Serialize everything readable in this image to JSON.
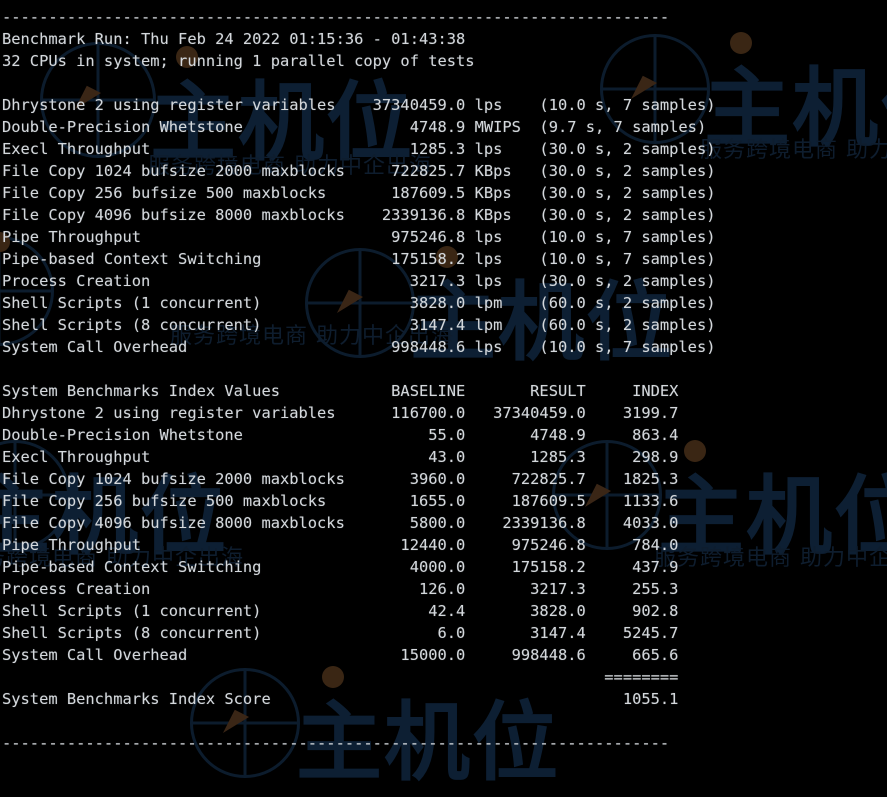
{
  "terminal": {
    "title": "UnixBench benchmark results terminal output",
    "background_color": "#000000",
    "text_color": "#d4d8dc",
    "rule_top": "------------------------------------------------------------------------",
    "rule_bottom": "------------------------------------------------------------------------",
    "header": {
      "benchmark_run_label": "Benchmark Run:",
      "date": "Thu Feb 24 2022",
      "time_start": "01:15:36",
      "time_separator": "-",
      "time_end": "01:43:38",
      "run_line": "Benchmark Run: Thu Feb 24 2022 01:15:36 - 01:43:38",
      "cpu_line": "32 CPUs in system; running 1 parallel copy of tests",
      "cpu_count": "32",
      "parallel_copies": "1"
    },
    "raw_results": {
      "rows": [
        {
          "name": "Dhrystone 2 using register variables",
          "value": "37340459.0",
          "unit": "lps",
          "duration": "10.0",
          "samples": "7",
          "detail": "(10.0 s, 7 samples)"
        },
        {
          "name": "Double-Precision Whetstone",
          "value": "4748.9",
          "unit": "MWIPS",
          "duration": "9.7",
          "samples": "7",
          "detail": "(9.7 s, 7 samples)"
        },
        {
          "name": "Execl Throughput",
          "value": "1285.3",
          "unit": "lps",
          "duration": "30.0",
          "samples": "2",
          "detail": "(30.0 s, 2 samples)"
        },
        {
          "name": "File Copy 1024 bufsize 2000 maxblocks",
          "value": "722825.7",
          "unit": "KBps",
          "duration": "30.0",
          "samples": "2",
          "detail": "(30.0 s, 2 samples)"
        },
        {
          "name": "File Copy 256 bufsize 500 maxblocks",
          "value": "187609.5",
          "unit": "KBps",
          "duration": "30.0",
          "samples": "2",
          "detail": "(30.0 s, 2 samples)"
        },
        {
          "name": "File Copy 4096 bufsize 8000 maxblocks",
          "value": "2339136.8",
          "unit": "KBps",
          "duration": "30.0",
          "samples": "2",
          "detail": "(30.0 s, 2 samples)"
        },
        {
          "name": "Pipe Throughput",
          "value": "975246.8",
          "unit": "lps",
          "duration": "10.0",
          "samples": "7",
          "detail": "(10.0 s, 7 samples)"
        },
        {
          "name": "Pipe-based Context Switching",
          "value": "175158.2",
          "unit": "lps",
          "duration": "10.0",
          "samples": "7",
          "detail": "(10.0 s, 7 samples)"
        },
        {
          "name": "Process Creation",
          "value": "3217.3",
          "unit": "lps",
          "duration": "30.0",
          "samples": "2",
          "detail": "(30.0 s, 2 samples)"
        },
        {
          "name": "Shell Scripts (1 concurrent)",
          "value": "3828.0",
          "unit": "lpm",
          "duration": "60.0",
          "samples": "2",
          "detail": "(60.0 s, 2 samples)"
        },
        {
          "name": "Shell Scripts (8 concurrent)",
          "value": "3147.4",
          "unit": "lpm",
          "duration": "60.0",
          "samples": "2",
          "detail": "(60.0 s, 2 samples)"
        },
        {
          "name": "System Call Overhead",
          "value": "998448.6",
          "unit": "lps",
          "duration": "10.0",
          "samples": "7",
          "detail": "(10.0 s, 7 samples)"
        }
      ]
    },
    "index_table": {
      "title": "System Benchmarks Index Values",
      "columns": [
        "BASELINE",
        "RESULT",
        "INDEX"
      ],
      "rows": [
        {
          "name": "Dhrystone 2 using register variables",
          "baseline": "116700.0",
          "result": "37340459.0",
          "index": "3199.7"
        },
        {
          "name": "Double-Precision Whetstone",
          "baseline": "55.0",
          "result": "4748.9",
          "index": "863.4"
        },
        {
          "name": "Execl Throughput",
          "baseline": "43.0",
          "result": "1285.3",
          "index": "298.9"
        },
        {
          "name": "File Copy 1024 bufsize 2000 maxblocks",
          "baseline": "3960.0",
          "result": "722825.7",
          "index": "1825.3"
        },
        {
          "name": "File Copy 256 bufsize 500 maxblocks",
          "baseline": "1655.0",
          "result": "187609.5",
          "index": "1133.6"
        },
        {
          "name": "File Copy 4096 bufsize 8000 maxblocks",
          "baseline": "5800.0",
          "result": "2339136.8",
          "index": "4033.0"
        },
        {
          "name": "Pipe Throughput",
          "baseline": "12440.0",
          "result": "975246.8",
          "index": "784.0"
        },
        {
          "name": "Pipe-based Context Switching",
          "baseline": "4000.0",
          "result": "175158.2",
          "index": "437.9"
        },
        {
          "name": "Process Creation",
          "baseline": "126.0",
          "result": "3217.3",
          "index": "255.3"
        },
        {
          "name": "Shell Scripts (1 concurrent)",
          "baseline": "42.4",
          "result": "3828.0",
          "index": "902.8"
        },
        {
          "name": "Shell Scripts (8 concurrent)",
          "baseline": "6.0",
          "result": "3147.4",
          "index": "5245.7"
        },
        {
          "name": "System Call Overhead",
          "baseline": "15000.0",
          "result": "998448.6",
          "index": "665.6"
        }
      ],
      "separator": "========",
      "score_label": "System Benchmarks Index Score",
      "score_value": "1055.1"
    }
  },
  "watermark": {
    "logo_text": "主机位",
    "logo_text_2": "主机位",
    "tagline": "服务跨境电商 助力中企出海",
    "color": "#0d1f33",
    "cursor_color": "#3a2614"
  }
}
